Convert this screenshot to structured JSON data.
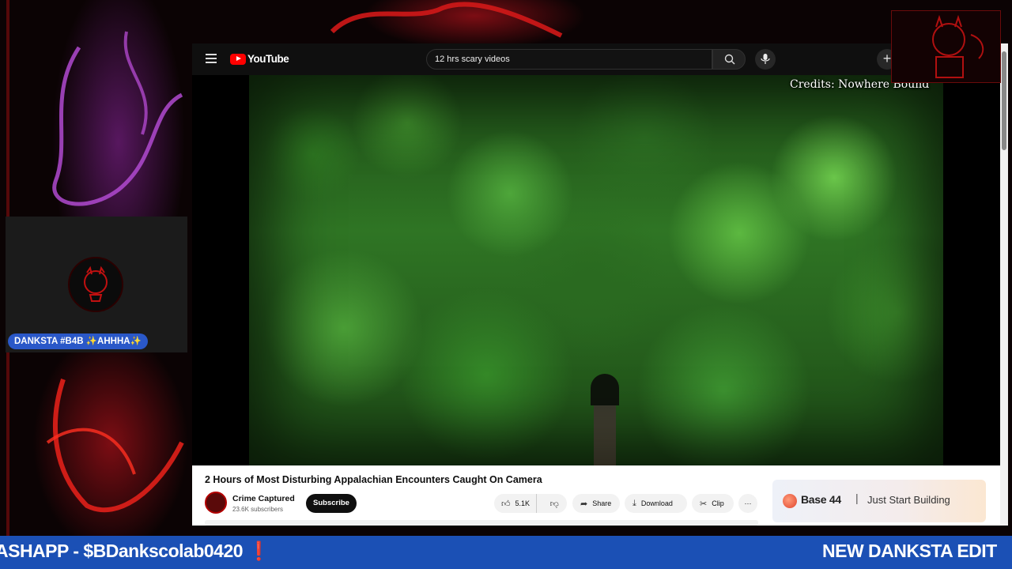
{
  "youtube": {
    "brand": "YouTube",
    "search_query": "12 hrs scary videos",
    "video_overlay_credit": "Credits: Nowhere Bound",
    "video_title": "2 Hours of Most Disturbing Appalachian Encounters Caught On Camera",
    "channel": {
      "name": "Crime Captured",
      "subscribers": "23.6K subscribers"
    },
    "subscribe_label": "Subscribe",
    "actions": {
      "likes": "5.1K",
      "share": "Share",
      "download": "Download",
      "clip": "Clip",
      "more": "···"
    },
    "ad": {
      "brand": "Base 44",
      "separator": "|",
      "tagline": "Just Start Building"
    }
  },
  "webcam": {
    "name_tag": "DANKSTA #B4B ✨AHHHA✨"
  },
  "ticker": {
    "items": [
      "ASHAPP - $BDankscolab0420 ❗",
      "NEW DANKSTA EDIT"
    ]
  },
  "colors": {
    "ticker_bg": "#1b50b5",
    "yt_red": "#ff0000",
    "accent_red": "#b01010"
  },
  "icons": [
    "menu-icon",
    "youtube-logo-icon",
    "search-icon",
    "mic-icon",
    "create-icon",
    "like-icon",
    "dislike-icon",
    "share-icon",
    "download-icon",
    "clip-icon"
  ]
}
